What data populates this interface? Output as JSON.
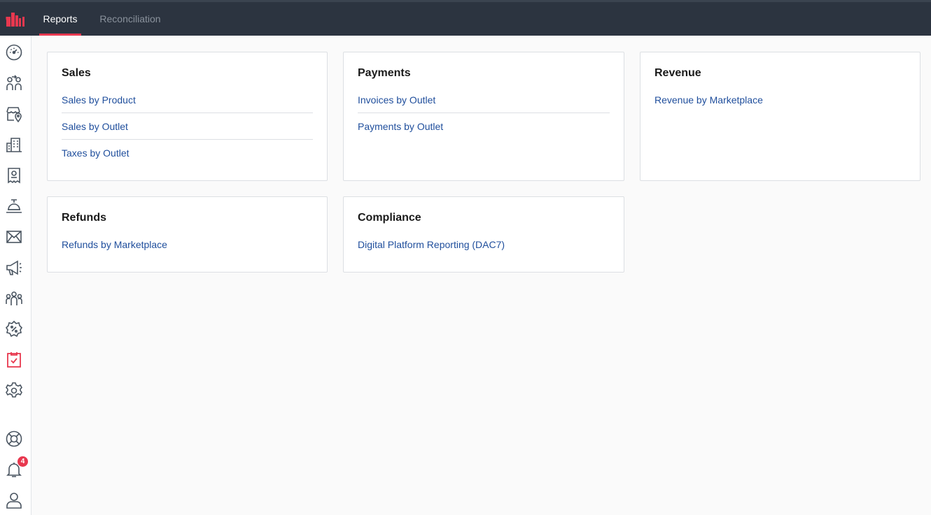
{
  "header": {
    "tabs": [
      {
        "label": "Reports",
        "active": true
      },
      {
        "label": "Reconciliation",
        "active": false
      }
    ]
  },
  "sidebar": {
    "items": [
      {
        "icon": "dashboard-icon"
      },
      {
        "icon": "users-exchange-icon"
      },
      {
        "icon": "store-location-icon"
      },
      {
        "icon": "buildings-icon"
      },
      {
        "icon": "receipt-icon"
      },
      {
        "icon": "reception-bell-icon"
      },
      {
        "icon": "mail-icon"
      },
      {
        "icon": "megaphone-icon"
      },
      {
        "icon": "team-icon"
      },
      {
        "icon": "discount-badge-icon"
      },
      {
        "icon": "reports-clipboard-icon",
        "active": true
      },
      {
        "icon": "settings-gear-icon"
      },
      {
        "icon": "support-lifebuoy-icon"
      },
      {
        "icon": "notifications-bell-icon",
        "badge": "4"
      },
      {
        "icon": "user-profile-icon"
      }
    ]
  },
  "cards": {
    "sales": {
      "title": "Sales",
      "links": [
        "Sales by Product",
        "Sales by Outlet",
        "Taxes by Outlet"
      ]
    },
    "payments": {
      "title": "Payments",
      "links": [
        "Invoices by Outlet",
        "Payments by Outlet"
      ]
    },
    "revenue": {
      "title": "Revenue",
      "links": [
        "Revenue by Marketplace"
      ]
    },
    "refunds": {
      "title": "Refunds",
      "links": [
        "Refunds by Marketplace"
      ]
    },
    "compliance": {
      "title": "Compliance",
      "links": [
        "Digital Platform Reporting (DAC7)"
      ]
    }
  },
  "colors": {
    "accent": "#e8384f",
    "topbar": "#2c3440",
    "link": "#1f4e9c",
    "icon": "#4a5561"
  }
}
